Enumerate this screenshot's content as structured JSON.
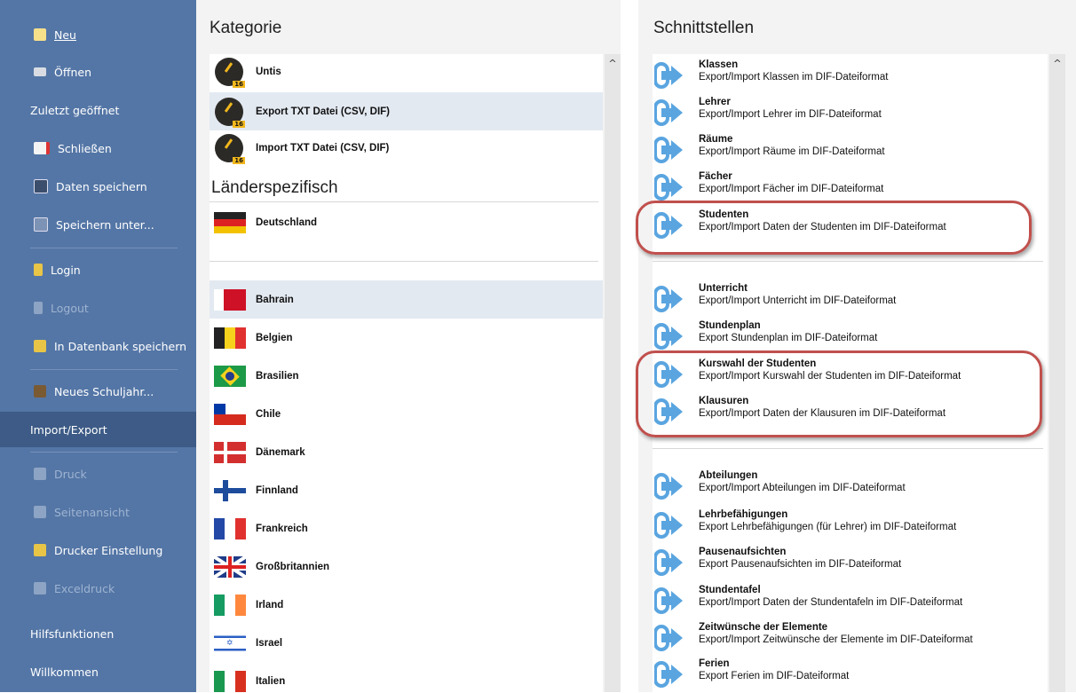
{
  "sidebar": {
    "items": [
      {
        "label": "Neu",
        "icon": "new-document-icon",
        "state": "normal"
      },
      {
        "label": "Öffnen",
        "icon": "open-folder-icon",
        "state": "normal"
      },
      {
        "label": "Zuletzt geöffnet",
        "icon": "",
        "state": "normal"
      },
      {
        "label": "Schließen",
        "icon": "close-document-icon",
        "state": "normal"
      },
      {
        "label": "Daten speichern",
        "icon": "save-icon",
        "state": "normal"
      },
      {
        "label": "Speichern unter...",
        "icon": "save-as-icon",
        "state": "normal"
      },
      {
        "label": "Login",
        "icon": "login-icon",
        "state": "normal"
      },
      {
        "label": "Logout",
        "icon": "logout-icon",
        "state": "disabled"
      },
      {
        "label": "In Datenbank speichern",
        "icon": "database-save-icon",
        "state": "normal"
      },
      {
        "label": "Neues Schuljahr...",
        "icon": "new-schoolyear-icon",
        "state": "normal"
      },
      {
        "label": "Import/Export",
        "icon": "",
        "state": "active"
      },
      {
        "label": "Druck",
        "icon": "print-icon",
        "state": "disabled"
      },
      {
        "label": "Seitenansicht",
        "icon": "page-preview-icon",
        "state": "disabled"
      },
      {
        "label": "Drucker Einstellung",
        "icon": "printer-settings-icon",
        "state": "normal"
      },
      {
        "label": "Exceldruck",
        "icon": "excel-print-icon",
        "state": "disabled"
      },
      {
        "label": "Hilfsfunktionen",
        "icon": "",
        "state": "normal"
      },
      {
        "label": "Willkommen",
        "icon": "",
        "state": "normal"
      }
    ]
  },
  "kategorie": {
    "title": "Kategorie",
    "items": [
      {
        "label": "Untis"
      },
      {
        "label": "Export TXT Datei (CSV, DIF)"
      },
      {
        "label": "Import TXT Datei (CSV, DIF)"
      }
    ],
    "badge": "16"
  },
  "laender": {
    "title": "Länderspezifisch",
    "items": [
      {
        "label": "Deutschland"
      },
      {
        "label": "Bahrain"
      },
      {
        "label": "Belgien"
      },
      {
        "label": "Brasilien"
      },
      {
        "label": "Chile"
      },
      {
        "label": "Dänemark"
      },
      {
        "label": "Finnland"
      },
      {
        "label": "Frankreich"
      },
      {
        "label": "Großbritannien"
      },
      {
        "label": "Irland"
      },
      {
        "label": "Israel"
      },
      {
        "label": "Italien"
      }
    ]
  },
  "schnittstellen": {
    "title": "Schnittstellen",
    "items": [
      {
        "title": "Klassen",
        "desc": "Export/Import Klassen im DIF-Dateiformat"
      },
      {
        "title": "Lehrer",
        "desc": "Export/Import Lehrer im DIF-Dateiformat"
      },
      {
        "title": "Räume",
        "desc": "Export/Import Räume im DIF-Dateiformat"
      },
      {
        "title": "Fächer",
        "desc": "Export/Import Fächer im DIF-Dateiformat"
      },
      {
        "title": "Studenten",
        "desc": "Export/Import Daten der Studenten im DIF-Dateiformat"
      },
      {
        "title": "Unterricht",
        "desc": "Export/Import Unterricht im DIF-Dateiformat"
      },
      {
        "title": "Stundenplan",
        "desc": "Export Stundenplan im DIF-Dateiformat"
      },
      {
        "title": "Kurswahl der Studenten",
        "desc": "Export/Import Kurswahl der Studenten im DIF-Dateiformat"
      },
      {
        "title": "Klausuren",
        "desc": "Export/Import Daten der Klausuren im DIF-Dateiformat"
      },
      {
        "title": "Abteilungen",
        "desc": "Export/Import Abteilungen im DIF-Dateiformat"
      },
      {
        "title": "Lehrbefähigungen",
        "desc": "Export Lehrbefähigungen (für Lehrer) im DIF-Dateiformat"
      },
      {
        "title": "Pausenaufsichten",
        "desc": "Export Pausenaufsichten im DIF-Dateiformat"
      },
      {
        "title": "Stundentafel",
        "desc": "Export/Import Daten der Stundentafeln im DIF-Dateiformat"
      },
      {
        "title": "Zeitwünsche der Elemente",
        "desc": "Export/Import Zeitwünsche der Elemente im DIF-Dateiformat"
      },
      {
        "title": "Ferien",
        "desc": "Export Ferien im DIF-Dateiformat"
      }
    ]
  },
  "colors": {
    "sidebar": "#5476a6",
    "sidebar_active": "#3d5b86",
    "highlight_oval": "#c0504d",
    "arrow_icon": "#5aa5e0"
  }
}
